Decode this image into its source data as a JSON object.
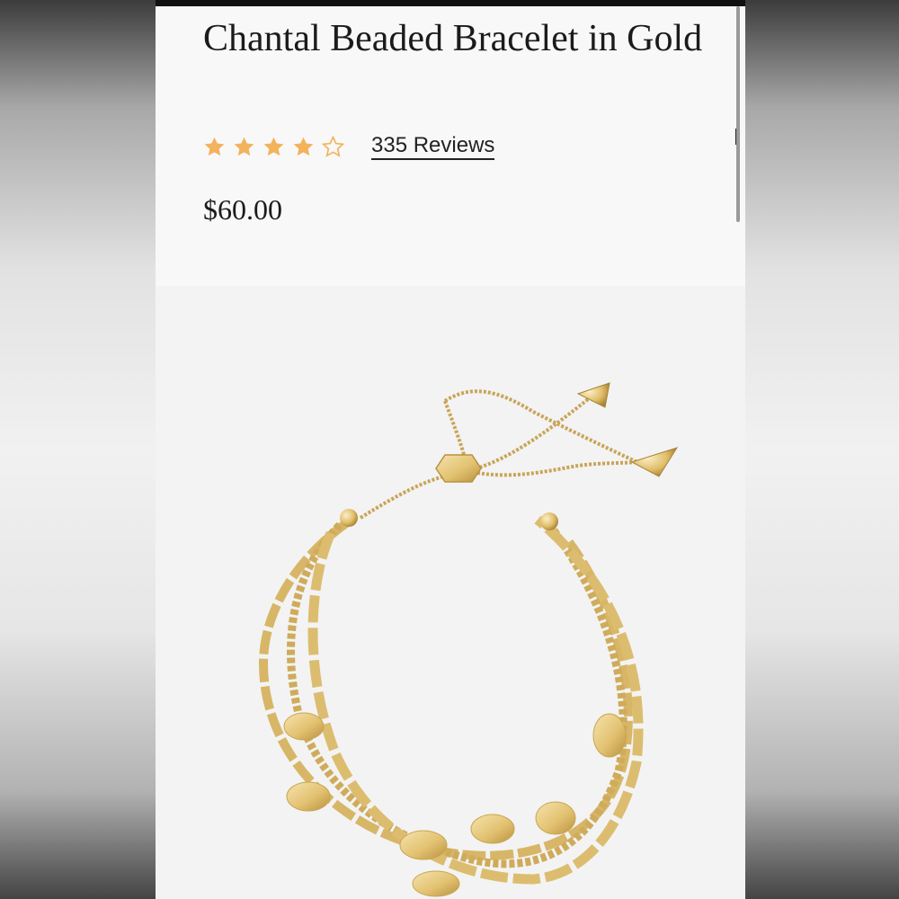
{
  "product": {
    "title": "Chantal Beaded Bracelet in Gold",
    "rating": 4,
    "rating_max": 5,
    "reviews_label": "335 Reviews",
    "price": "$60.00"
  },
  "colors": {
    "star_filled": "#f3b35c",
    "star_empty": "#f3b35c",
    "gold": "#e3c372",
    "gold_dark": "#b9913f",
    "gold_light": "#f6e3b0"
  }
}
